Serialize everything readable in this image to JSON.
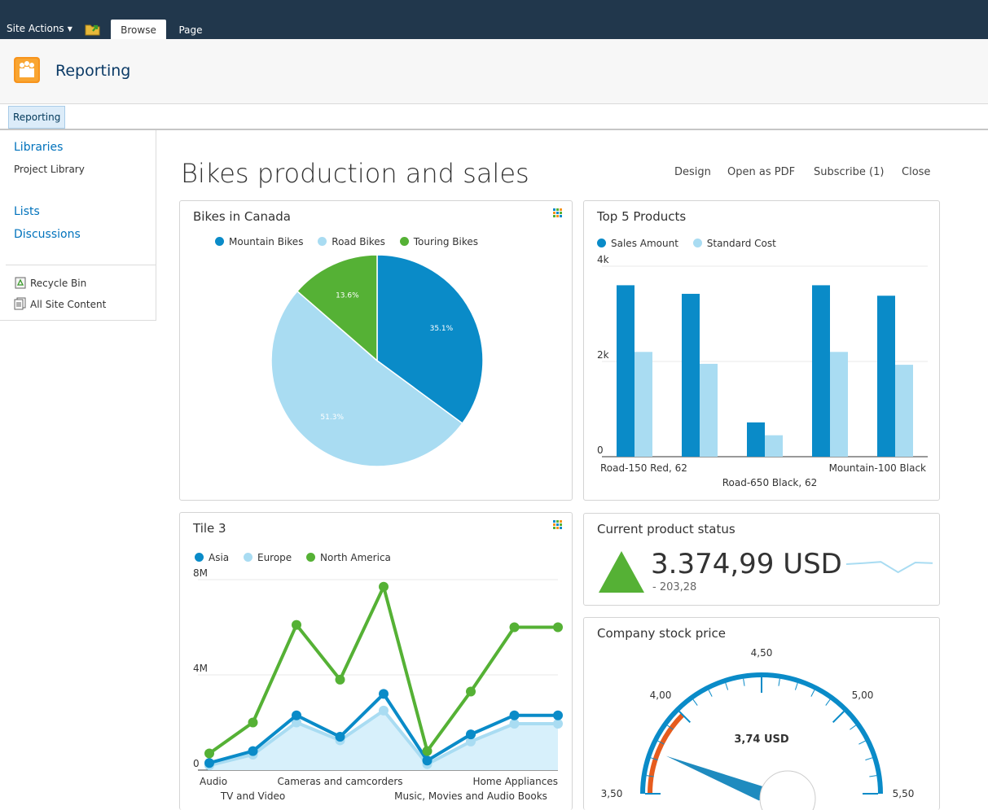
{
  "ribbon": {
    "site_actions": "Site Actions",
    "tabs": [
      {
        "label": "Browse"
      },
      {
        "label": "Page"
      }
    ]
  },
  "site": {
    "title": "Reporting"
  },
  "topnav": {
    "items": [
      {
        "label": "Reporting"
      }
    ]
  },
  "quicklaunch": {
    "libraries": "Libraries",
    "project_library": "Project Library",
    "lists": "Lists",
    "discussions": "Discussions",
    "recycle_bin": "Recycle Bin",
    "all_site_content": "All Site Content"
  },
  "dashboard": {
    "title": "Bikes production and sales",
    "actions": {
      "design": "Design",
      "pdf": "Open as PDF",
      "subscribe": "Subscribe (1)",
      "close": "Close"
    }
  },
  "tiles": {
    "pie": {
      "title": "Bikes in Canada"
    },
    "bar": {
      "title": "Top 5 Products"
    },
    "line": {
      "title": "Tile 3"
    },
    "kpi": {
      "title": "Current product status",
      "value": "3.374,99 USD",
      "delta": "- 203,28",
      "trend": "up",
      "spark": [
        0.55,
        0.58,
        0.62,
        0.3,
        0.6,
        0.58
      ]
    },
    "gauge": {
      "title": "Company stock price",
      "value_label": "3,74 USD",
      "value": 3.74,
      "min": 3.5,
      "max": 5.5,
      "ticks": [
        "3,50",
        "4,00",
        "4,50",
        "5,00",
        "5,50"
      ]
    }
  },
  "chart_data": [
    {
      "type": "pie",
      "title": "Bikes in Canada",
      "series": [
        {
          "name": "Mountain Bikes",
          "value": 35.1,
          "label": "35.1%"
        },
        {
          "name": "Road Bikes",
          "value": 51.3,
          "label": "51.3%"
        },
        {
          "name": "Touring Bikes",
          "value": 13.6,
          "label": "13.6%"
        }
      ],
      "colors": [
        "#0a8bc8",
        "#a9dcf2",
        "#55b135"
      ],
      "legend": "top"
    },
    {
      "type": "bar",
      "title": "Top 5 Products",
      "series": [
        {
          "name": "Sales Amount",
          "values": [
            3600,
            3420,
            720,
            3600,
            3380
          ],
          "color": "#0a8bc8"
        },
        {
          "name": "Standard Cost",
          "values": [
            2200,
            1950,
            450,
            2200,
            1930
          ],
          "color": "#a9dcf2"
        }
      ],
      "categories": [
        "Road-150 Red, 62",
        "",
        "Road-650 Black, 62",
        "",
        "Mountain-100 Black"
      ],
      "yticks": [
        "0",
        "2k",
        "4k"
      ],
      "ylim": [
        0,
        4000
      ],
      "legend": "top",
      "grid": true
    },
    {
      "type": "line",
      "title": "Tile 3",
      "categories": [
        "Audio",
        "TV and Video",
        "",
        "Cameras and camcorders",
        "",
        "",
        "Music, Movies and Audio Books",
        "Home Appliances",
        ""
      ],
      "series": [
        {
          "name": "Asia",
          "values": [
            300000,
            800000,
            2300000,
            1400000,
            3200000,
            400000,
            1500000,
            2300000,
            2300000
          ],
          "color": "#0a8bc8"
        },
        {
          "name": "Europe",
          "values": [
            200000,
            650000,
            2000000,
            1250000,
            2500000,
            250000,
            1200000,
            1950000,
            1950000
          ],
          "color": "#a9dcf2"
        },
        {
          "name": "North America",
          "values": [
            700000,
            2000000,
            6100000,
            3800000,
            7700000,
            800000,
            3300000,
            6000000,
            6000000
          ],
          "color": "#55b135"
        }
      ],
      "yticks": [
        "0",
        "4M",
        "8M"
      ],
      "ylim": [
        0,
        8000000
      ],
      "legend": "top",
      "grid": true
    }
  ]
}
